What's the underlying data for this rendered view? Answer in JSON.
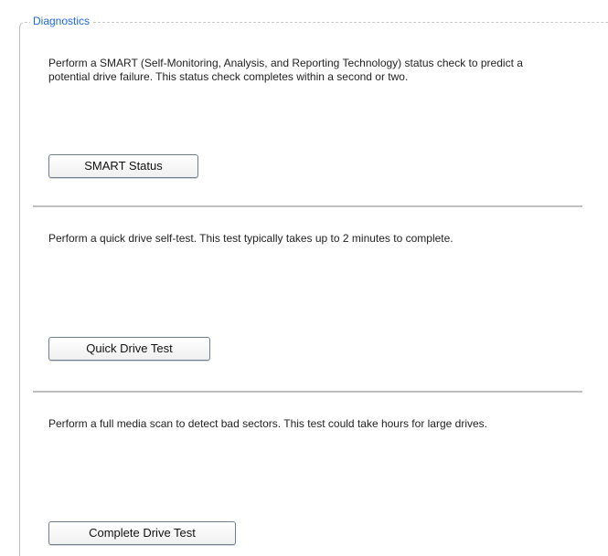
{
  "group": {
    "title": "Diagnostics"
  },
  "sections": [
    {
      "description": "Perform a SMART (Self-Monitoring, Analysis, and Reporting Technology) status check to predict a potential drive failure. This status check completes within a second or two.",
      "button_label": "SMART Status"
    },
    {
      "description": "Perform a quick drive self-test. This test typically takes up to 2 minutes to complete.",
      "button_label": "Quick Drive Test"
    },
    {
      "description": "Perform a full media scan to detect bad sectors. This test could take hours for large drives.",
      "button_label": "Complete Drive Test"
    }
  ],
  "colors": {
    "legend_text": "#1f6ad6",
    "divider": "#bfbfbf",
    "button_border": "#6f7f92"
  }
}
